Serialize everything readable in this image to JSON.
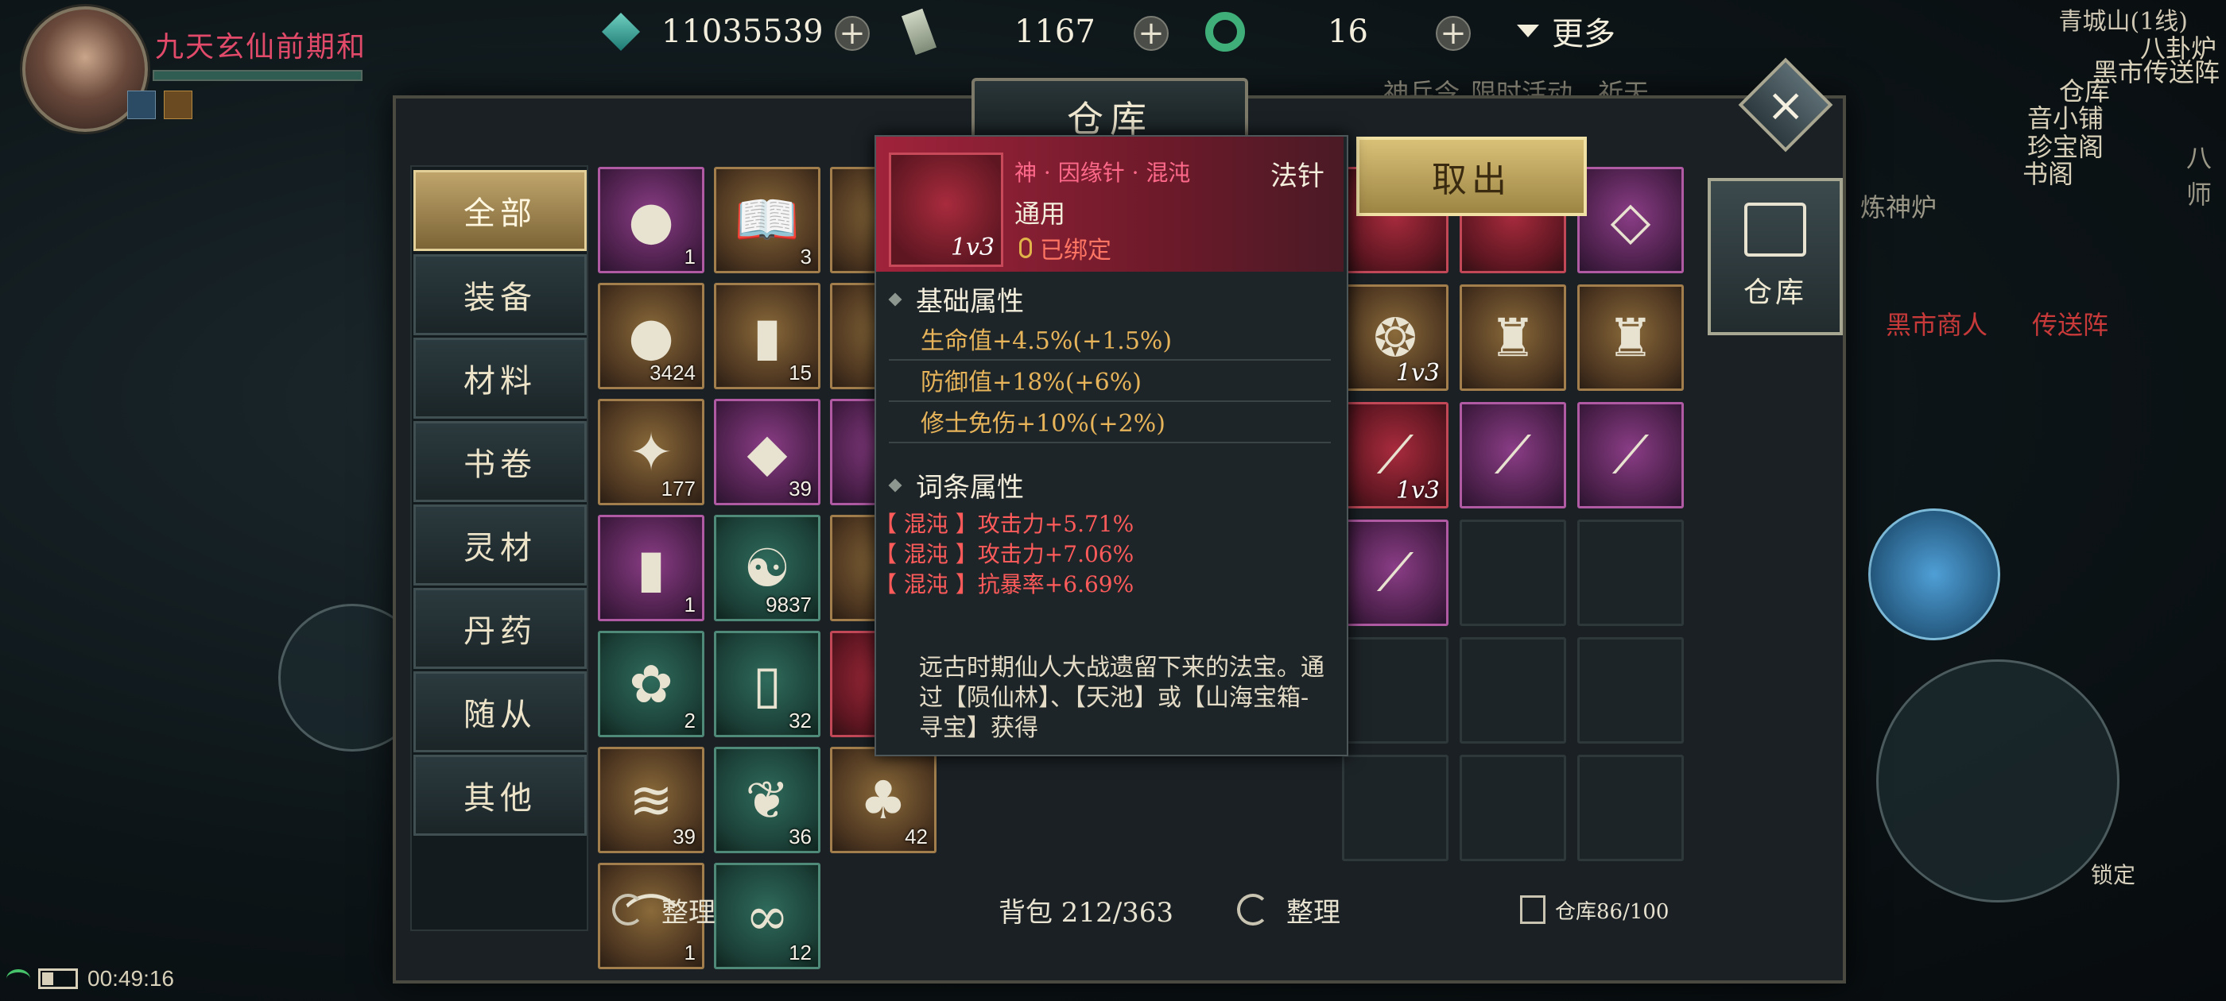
{
  "hud": {
    "player_name": "九天玄仙前期和",
    "resources": [
      {
        "icon": "jade-crystal-icon",
        "value": "11035539"
      },
      {
        "icon": "spirit-token-icon",
        "value": "1167"
      },
      {
        "icon": "jade-ring-icon",
        "value": "16"
      }
    ],
    "more_label": "更多",
    "map_line": "青城山(1线)",
    "right_labels": [
      "八卦炉",
      "黑市传送阵",
      "仓库",
      "音小铺",
      "珍宝阁",
      "书阁",
      "神兵令",
      "限时活动",
      "祈天",
      "炼神炉",
      "八师",
      "黑市商人",
      "传送阵"
    ],
    "lock_label": "锁定",
    "time": "00:49:16"
  },
  "panel": {
    "title": "仓库",
    "side_tab_label": "仓库",
    "take_out_label": "取出",
    "categories": [
      "全部",
      "装备",
      "材料",
      "书卷",
      "灵材",
      "丹药",
      "随从",
      "其他"
    ],
    "bag": {
      "sort_label": "整理",
      "capacity_label": "背包 212/363",
      "slots": [
        {
          "rarity": "purple",
          "glyph": "●",
          "count": "1"
        },
        {
          "rarity": "gold",
          "glyph": "📖",
          "count": "3"
        },
        {
          "rarity": "gold",
          "glyph": "",
          "count": ""
        },
        {
          "rarity": "gold",
          "glyph": "●",
          "count": "3424"
        },
        {
          "rarity": "gold",
          "glyph": "▮",
          "count": "15"
        },
        {
          "rarity": "gold",
          "glyph": "",
          "count": ""
        },
        {
          "rarity": "gold",
          "glyph": "✦",
          "count": "177"
        },
        {
          "rarity": "purple",
          "glyph": "◆",
          "count": "39"
        },
        {
          "rarity": "purple",
          "glyph": "",
          "count": ""
        },
        {
          "rarity": "purple",
          "glyph": "▮",
          "count": "1"
        },
        {
          "rarity": "green",
          "glyph": "☯",
          "count": "9837"
        },
        {
          "rarity": "gold",
          "glyph": "",
          "count": ""
        },
        {
          "rarity": "green",
          "glyph": "✿",
          "count": "2"
        },
        {
          "rarity": "green",
          "glyph": "▯",
          "count": "32"
        },
        {
          "rarity": "red",
          "glyph": "",
          "count": ""
        },
        {
          "rarity": "gold",
          "glyph": "≋",
          "count": "39"
        },
        {
          "rarity": "green",
          "glyph": "❦",
          "count": "36"
        },
        {
          "rarity": "gold",
          "glyph": "♣",
          "count": "42"
        },
        {
          "rarity": "gold",
          "glyph": "⌒",
          "count": "1"
        },
        {
          "rarity": "green",
          "glyph": "∞",
          "count": "12"
        }
      ]
    },
    "storage": {
      "sort_label": "整理",
      "capacity_label": "仓库86/100",
      "slots": [
        {
          "rarity": "red",
          "glyph": "",
          "lvl": ""
        },
        {
          "rarity": "red",
          "glyph": "",
          "lvl": ""
        },
        {
          "rarity": "purple",
          "glyph": "◇",
          "lvl": ""
        },
        {
          "rarity": "gold",
          "glyph": "❂",
          "lvl": "1v3"
        },
        {
          "rarity": "gold",
          "glyph": "♜",
          "lvl": ""
        },
        {
          "rarity": "gold",
          "glyph": "♜",
          "lvl": ""
        },
        {
          "rarity": "red",
          "glyph": "⟋",
          "lvl": "1v3"
        },
        {
          "rarity": "purple",
          "glyph": "⟋",
          "lvl": ""
        },
        {
          "rarity": "purple",
          "glyph": "⟋",
          "lvl": ""
        },
        {
          "rarity": "purple",
          "glyph": "⟋",
          "lvl": ""
        },
        {
          "rarity": "empty",
          "glyph": "",
          "lvl": ""
        },
        {
          "rarity": "empty",
          "glyph": "",
          "lvl": ""
        },
        {
          "rarity": "empty",
          "glyph": "",
          "lvl": ""
        },
        {
          "rarity": "empty",
          "glyph": "",
          "lvl": ""
        },
        {
          "rarity": "empty",
          "glyph": "",
          "lvl": ""
        },
        {
          "rarity": "empty",
          "glyph": "",
          "lvl": ""
        },
        {
          "rarity": "empty",
          "glyph": "",
          "lvl": ""
        },
        {
          "rarity": "empty",
          "glyph": "",
          "lvl": ""
        }
      ]
    }
  },
  "tooltip": {
    "name": "神 · 因缘针 · 混沌",
    "type": "法针",
    "usage": "通用",
    "level": "1v3",
    "bound": "已绑定",
    "base_title": "基础属性",
    "base_stats": [
      "生命值+4.5%(+1.5%)",
      "防御值+18%(+6%)",
      "修士免伤+10%(+2%)"
    ],
    "affix_title": "词条属性",
    "affixes": [
      "【 混沌 】攻击力+5.71%",
      "【 混沌 】攻击力+7.06%",
      "【 混沌 】抗暴率+6.69%"
    ],
    "description": "远古时期仙人大战遗留下来的法宝。通过【陨仙林】、【天池】或【山海宝箱-寻宝】获得"
  }
}
